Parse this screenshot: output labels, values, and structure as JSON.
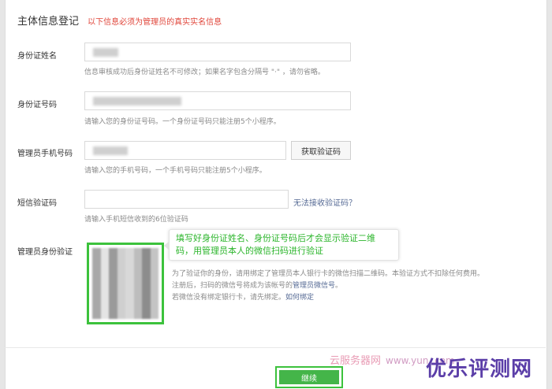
{
  "header": {
    "title": "主体信息登记",
    "note": "以下信息必须为管理员的真实实名信息"
  },
  "fields": {
    "id_name": {
      "label": "身份证姓名",
      "hint": "信息审核成功后身份证姓名不可修改；如果名字包含分隔号 \"·\" ，请勿省略。"
    },
    "id_number": {
      "label": "身份证号码",
      "hint": "请输入您的身份证号码。一个身份证号码只能注册5个小程序。"
    },
    "phone": {
      "label": "管理员手机号码",
      "hint": "请输入您的手机号码，一个手机号码只能注册5个小程序。",
      "button": "获取验证码"
    },
    "sms": {
      "label": "短信验证码",
      "link": "无法接收验证码？",
      "hint": "请输入手机短信收到的6位验证码"
    },
    "verify": {
      "label": "管理员身份验证",
      "desc_line1": "为了验证你的身份，请用绑定了管理员本人银行卡的微信扫描二维码。本验证方式不扣除任何费用。",
      "desc_line2_prefix": "注册后，扫码的微信号将成为该帐号的",
      "desc_line2_link": "管理员微信号",
      "desc_line2_suffix": "。",
      "desc_line3_prefix": "若微信没有绑定银行卡，请先绑定。",
      "desc_line3_link": "如何绑定"
    }
  },
  "tooltip": "填写好身份证姓名、身份证号码后才会显示验证二维码，用管理员本人的微信扫码进行验证",
  "submit_label": "继续",
  "watermark": {
    "small": "云服务器网",
    "url": "www.yun..com",
    "big": "优乐评测网"
  },
  "colors": {
    "accent_green": "#44b549",
    "highlight_green": "#3cc23c",
    "warning_red": "#e0453a",
    "link_blue": "#576b95"
  }
}
